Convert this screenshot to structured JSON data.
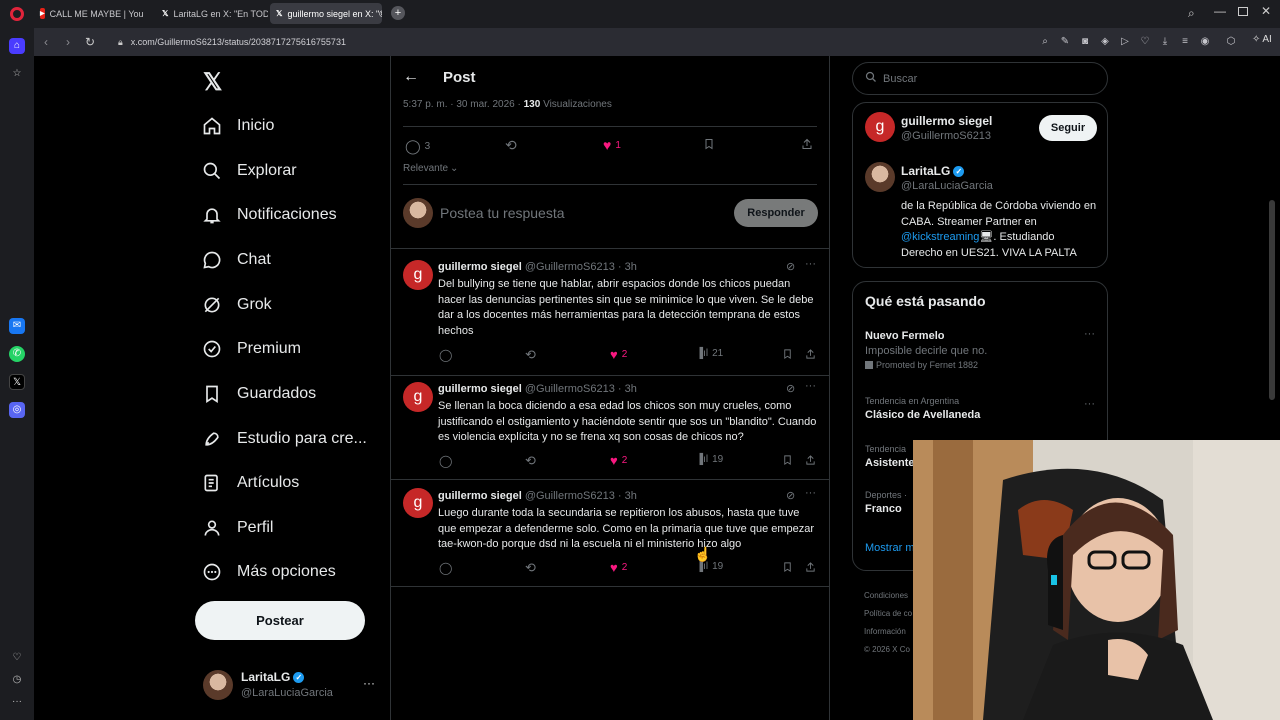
{
  "browser": {
    "tabs": [
      {
        "label": "CALL ME MAYBE | You",
        "icon": "youtube-icon"
      },
      {
        "label": "LaritaLG en X: \"En TODAS",
        "icon": "x-logo-icon"
      },
      {
        "label": "guillermo siegel en X: \"©",
        "icon": "x-logo-icon"
      }
    ],
    "url": "x.com/GuillermoS6213/status/2038717275616755731",
    "ai_label": "AI"
  },
  "nav": {
    "items": [
      {
        "label": "Inicio",
        "icon": "home-icon"
      },
      {
        "label": "Explorar",
        "icon": "search-icon"
      },
      {
        "label": "Notificaciones",
        "icon": "bell-icon"
      },
      {
        "label": "Chat",
        "icon": "chat-icon"
      },
      {
        "label": "Grok",
        "icon": "grok-icon"
      },
      {
        "label": "Premium",
        "icon": "premium-icon"
      },
      {
        "label": "Guardados",
        "icon": "bookmark-icon"
      },
      {
        "label": "Estudio para cre...",
        "icon": "rocket-icon"
      },
      {
        "label": "Artículos",
        "icon": "article-icon"
      },
      {
        "label": "Perfil",
        "icon": "person-icon"
      },
      {
        "label": "Más opciones",
        "icon": "more-circle-icon"
      }
    ],
    "post_button": "Postear",
    "account": {
      "name": "LaritaLG",
      "handle": "@LaraLuciaGarcia"
    }
  },
  "post": {
    "header_title": "Post",
    "timestamp": "5:37 p. m. · 30 mar. 2026 ·",
    "views_count": "130",
    "views_label": "Visualizaciones",
    "reply_count": "3",
    "like_count": "1",
    "sort_label": "Relevante",
    "reply_placeholder": "Postea tu respuesta",
    "reply_button": "Responder"
  },
  "replies": [
    {
      "name": "guillermo siegel",
      "handle": "@GuillermoS6213",
      "time": "· 3h",
      "text": "Del bullying se tiene que hablar, abrir espacios donde los chicos puedan hacer las denuncias pertinentes sin que se minimice lo que viven. Se le debe dar a los docentes más herramientas para la detección temprana de estos hechos",
      "likes": "2",
      "views": "21"
    },
    {
      "name": "guillermo siegel",
      "handle": "@GuillermoS6213",
      "time": "· 3h",
      "text": "Se llenan la boca diciendo a esa edad los chicos son muy crueles, como justificando el ostigamiento y haciéndote sentir que sos un \"blandito\". Cuando es violencia explícita y no se frena xq son cosas de chicos no?",
      "likes": "2",
      "views": "19"
    },
    {
      "name": "guillermo siegel",
      "handle": "@GuillermoS6213",
      "time": "· 3h",
      "text": "Luego durante toda la secundaria se repitieron los abusos, hasta que tuve que empezar a defenderme solo. Como en la primaria que tuve que empezar tae-kwon-do porque dsd ni la escuela ni el ministerio hizo algo",
      "likes": "2",
      "views": "19"
    }
  ],
  "sidebar": {
    "search_placeholder": "Buscar",
    "profile": {
      "name": "guillermo siegel",
      "handle": "@GuillermoS6213",
      "follow_label": "Seguir"
    },
    "author": {
      "name": "LaritaLG",
      "handle": "@LaraLuciaGarcia",
      "bio_1": "de la República de Córdoba viviendo en CABA. Streamer Partner en",
      "bio_link": "@kickstreaming",
      "bio_2": ". Estudiando Derecho en UES21. VIVA LA PALTA"
    },
    "trends_title": "Qué está pasando",
    "trends": [
      {
        "meta": "",
        "title": "Nuevo Fermelo",
        "sub": "Imposible decirle que no.",
        "promo": "Promoted by Fernet 1882"
      },
      {
        "meta": "Tendencia en Argentina",
        "title": "Clásico de Avellaneda"
      },
      {
        "meta": "Tendencia",
        "title": "Asistente"
      },
      {
        "meta": "Deportes ·",
        "title": "Franco"
      }
    ],
    "show_more": "Mostrar m",
    "footer": [
      "Condiciones",
      "Política de co",
      "Información",
      "© 2026 X Co"
    ]
  },
  "colors": {
    "like": "#f91880",
    "link": "#1d9bf0",
    "verified": "#1d9bf0",
    "avatar_g": "#c62828"
  }
}
